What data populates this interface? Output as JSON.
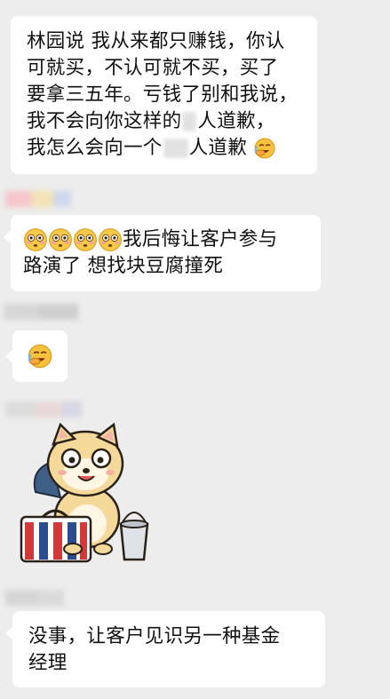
{
  "messages": [
    {
      "lines": [
        "林园说 我从来都只赚钱，你认",
        "可就买，不认可就不买，买了",
        "要拿三五年。亏钱了别和我说，"
      ],
      "line4_a": "我不会向你这样的",
      "line4_b": "人道歉，",
      "line5_a": "我怎么会向一个",
      "line5_b": "人道歉",
      "trailing_emoji": "facepalm-laugh"
    },
    {
      "emojis": [
        "flushed-face",
        "flushed-face",
        "flushed-face",
        "flushed-face"
      ],
      "line1": "我后悔让客户参与",
      "line2": "路演了 想找块豆腐撞死"
    },
    {
      "emoji": "facepalm-laugh"
    },
    {
      "sticker": "shiba-dog-with-luggage-sticker"
    },
    {
      "line1": "没事，让客户见识另一种基金",
      "line2": "经理"
    }
  ],
  "colors": {
    "background": "#ededed",
    "bubble": "#ffffff",
    "text": "#111111"
  }
}
